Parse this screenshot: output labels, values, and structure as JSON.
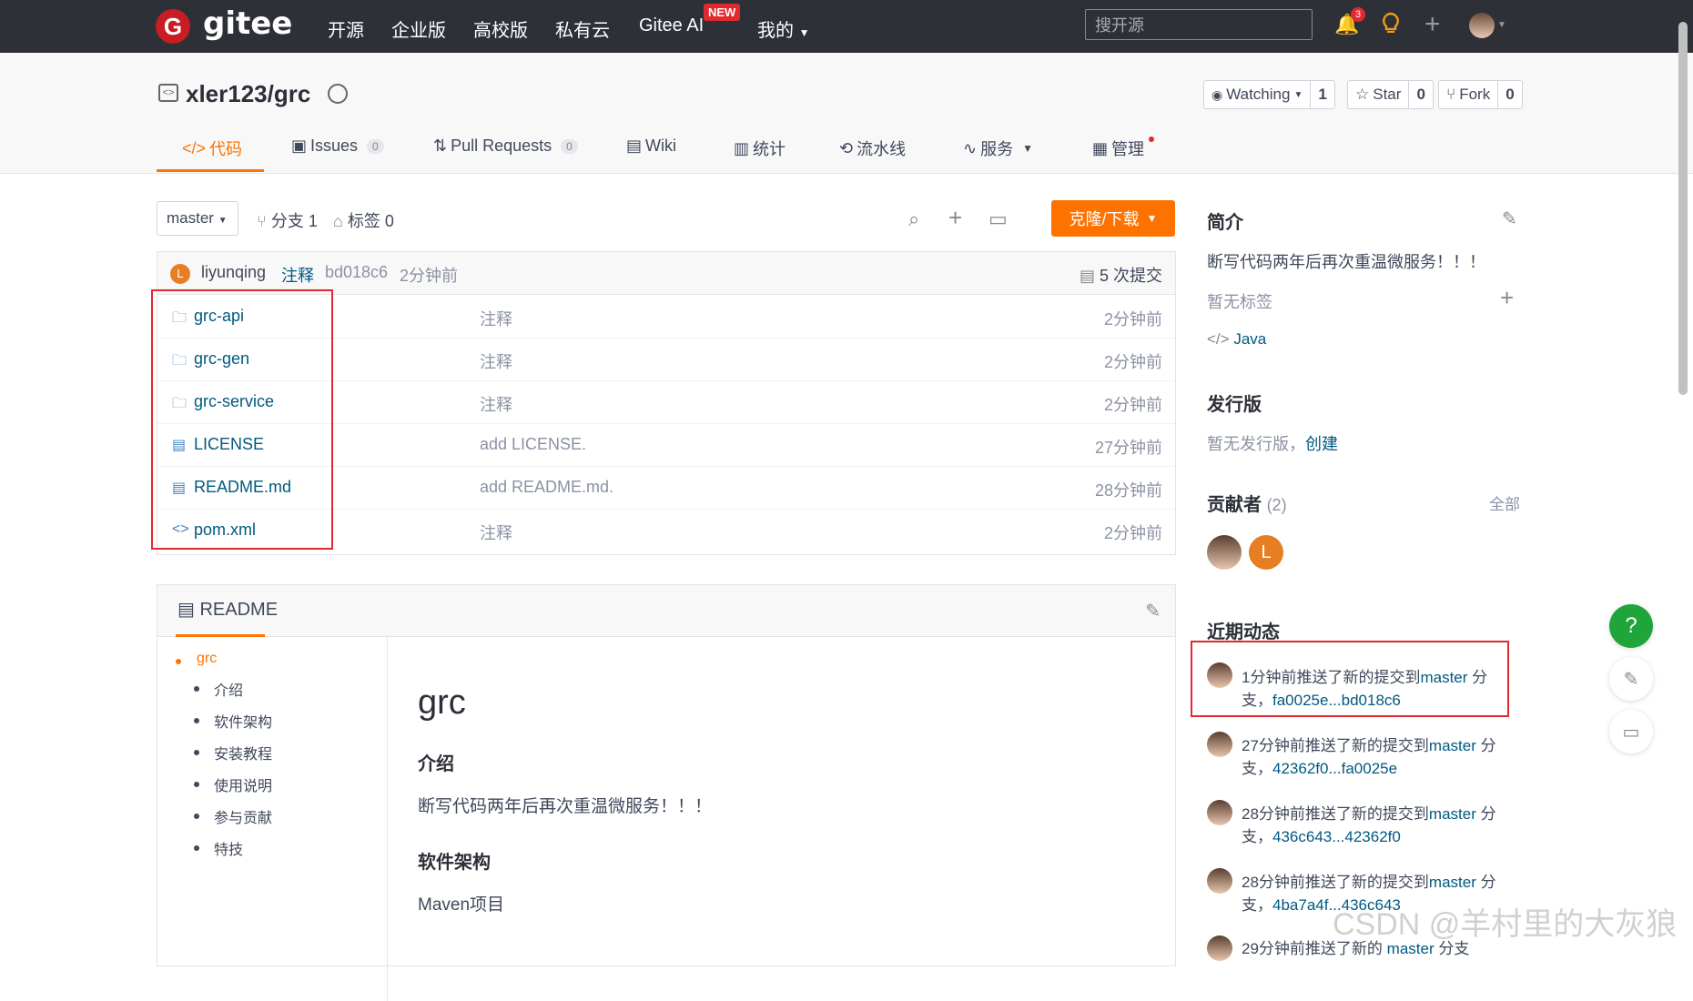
{
  "topnav": {
    "logo": "gitee",
    "items": [
      "开源",
      "企业版",
      "高校版",
      "私有云",
      "Gitee AI",
      "我的"
    ],
    "new_badge": "NEW",
    "search_placeholder": "搜开源",
    "notification_count": "3"
  },
  "repo": {
    "title": "xler123/grc",
    "watching_label": "Watching",
    "watching_count": "1",
    "star_label": "Star",
    "star_count": "0",
    "fork_label": "Fork",
    "fork_count": "0"
  },
  "tabs": [
    {
      "label": "代码",
      "icon": "code-icon",
      "active": true
    },
    {
      "label": "Issues",
      "badge": "0",
      "icon": "issues-icon"
    },
    {
      "label": "Pull Requests",
      "badge": "0",
      "icon": "pr-icon"
    },
    {
      "label": "Wiki",
      "icon": "wiki-icon"
    },
    {
      "label": "统计",
      "icon": "stats-icon"
    },
    {
      "label": "流水线",
      "icon": "pipeline-icon"
    },
    {
      "label": "服务",
      "icon": "service-icon"
    },
    {
      "label": "管理",
      "icon": "manage-icon"
    }
  ],
  "toolbar": {
    "branch": "master",
    "branches": "分支 1",
    "tags": "标签 0",
    "clone_label": "克隆/下载"
  },
  "commit": {
    "avatar_letter": "L",
    "author": "liyunqing",
    "message": "注释",
    "hash": "bd018c6",
    "time": "2分钟前",
    "commit_count": "5 次提交"
  },
  "files": [
    {
      "icon": "folder-icon",
      "name": "grc-api",
      "message": "注释",
      "time": "2分钟前"
    },
    {
      "icon": "folder-icon",
      "name": "grc-gen",
      "message": "注释",
      "time": "2分钟前"
    },
    {
      "icon": "folder-icon",
      "name": "grc-service",
      "message": "注释",
      "time": "2分钟前"
    },
    {
      "icon": "doc-icon",
      "name": "LICENSE",
      "message": "add LICENSE.",
      "time": "27分钟前"
    },
    {
      "icon": "doc-icon",
      "name": "README.md",
      "message": "add README.md.",
      "time": "28分钟前"
    },
    {
      "icon": "code-icon",
      "name": "pom.xml",
      "message": "注释",
      "time": "2分钟前"
    }
  ],
  "readme": {
    "tab_label": "README",
    "toc_root": "grc",
    "toc": [
      "介绍",
      "软件架构",
      "安装教程",
      "使用说明",
      "参与贡献",
      "特技"
    ],
    "h1": "grc",
    "h_intro": "介绍",
    "intro": "断写代码两年后再次重温微服务！！！",
    "h_arch": "软件架构",
    "arch": "Maven项目"
  },
  "sidebar": {
    "intro_title": "简介",
    "intro_text": "断写代码两年后再次重温微服务！！！",
    "no_tags": "暂无标签",
    "language": "Java",
    "release_title": "发行版",
    "no_release": "暂无发行版，",
    "create": "创建",
    "contrib_title": "贡献者",
    "contrib_count": "(2)",
    "all": "全部",
    "contrib_letter": "L",
    "activity_title": "近期动态",
    "activities": [
      {
        "text": "1分钟前推送了新的提交到",
        "branch": "master",
        "suffix": "分支，",
        "range": "fa0025e...bd018c6"
      },
      {
        "text": "27分钟前推送了新的提交到",
        "branch": "master",
        "suffix": "分支，",
        "range": "42362f0...fa0025e"
      },
      {
        "text": "28分钟前推送了新的提交到",
        "branch": "master",
        "suffix": "分支，",
        "range": "436c643...42362f0"
      },
      {
        "text": "28分钟前推送了新的提交到",
        "branch": "master",
        "suffix": "分支，",
        "range": "4ba7a4f...436c643"
      },
      {
        "text": "29分钟前推送了新的",
        "branch": "master",
        "suffix": "分支",
        "range": ""
      }
    ]
  },
  "watermark": "CSDN @羊村里的大灰狼",
  "colors": {
    "accent": "#fe7300",
    "nav_bg": "#2e3038",
    "link": "#005980",
    "highlight": "#e3282f"
  }
}
